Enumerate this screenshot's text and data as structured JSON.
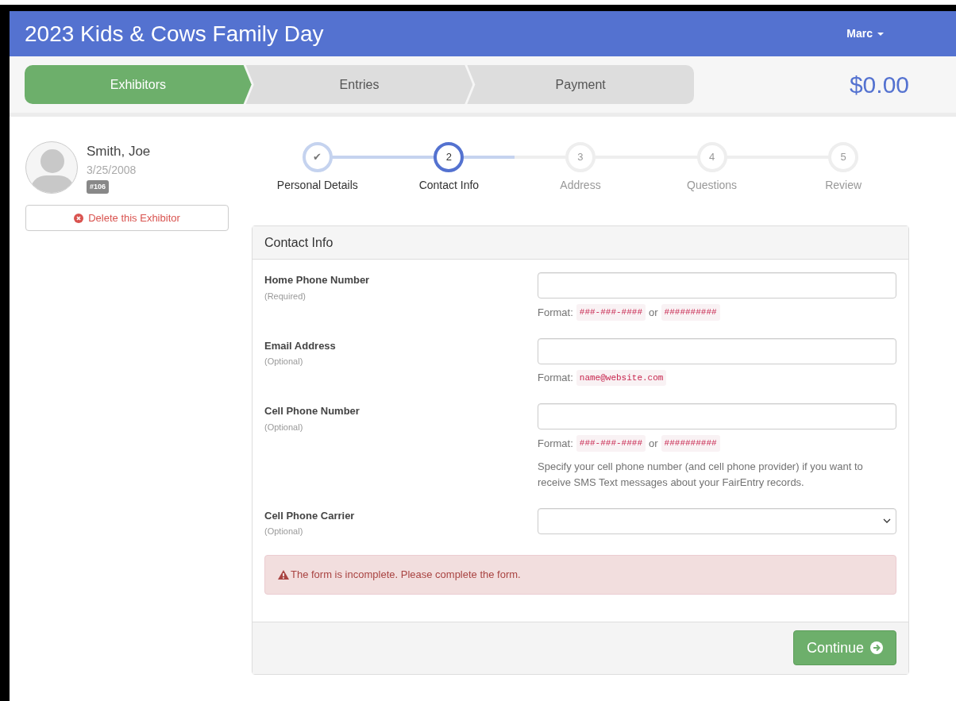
{
  "header": {
    "title": "2023 Kids & Cows Family Day",
    "user": "Marc"
  },
  "pipeline": [
    {
      "label": "Exhibitors",
      "selected": true
    },
    {
      "label": "Entries",
      "selected": false
    },
    {
      "label": "Payment",
      "selected": false
    }
  ],
  "total": "$0.00",
  "exhibitor": {
    "name": "Smith, Joe",
    "birthdate": "3/25/2008",
    "number": "#106",
    "delete_label": "Delete this Exhibitor"
  },
  "wizard": [
    {
      "marker": "✔",
      "label": "Personal Details",
      "kind": "complete"
    },
    {
      "marker": "2",
      "label": "Contact Info",
      "kind": "current"
    },
    {
      "marker": "3",
      "label": "Address",
      "kind": "pending"
    },
    {
      "marker": "4",
      "label": "Questions",
      "kind": "pending"
    },
    {
      "marker": "5",
      "label": "Review",
      "kind": "pending"
    }
  ],
  "panel": {
    "title": "Contact Info",
    "fields": [
      {
        "kind": "text",
        "label": "Home Phone Number",
        "note": "(Required)",
        "format": {
          "label": "Format:",
          "codes": [
            "###-###-####",
            "##########"
          ],
          "separator": "or"
        }
      },
      {
        "kind": "text",
        "label": "Email Address",
        "note": "(Optional)",
        "format": {
          "label": "Format:",
          "codes": [
            "name@website.com"
          ]
        }
      },
      {
        "kind": "text",
        "label": "Cell Phone Number",
        "note": "(Optional)",
        "format": {
          "label": "Format:",
          "codes": [
            "###-###-####",
            "##########"
          ],
          "separator": "or"
        },
        "help": "Specify your cell phone number (and cell phone provider) if you want to receive SMS Text messages about your FairEntry records."
      },
      {
        "kind": "select",
        "label": "Cell Phone Carrier",
        "note": "(Optional)"
      }
    ],
    "alert": "The form is incomplete. Please complete the form.",
    "continue": "Continue"
  }
}
